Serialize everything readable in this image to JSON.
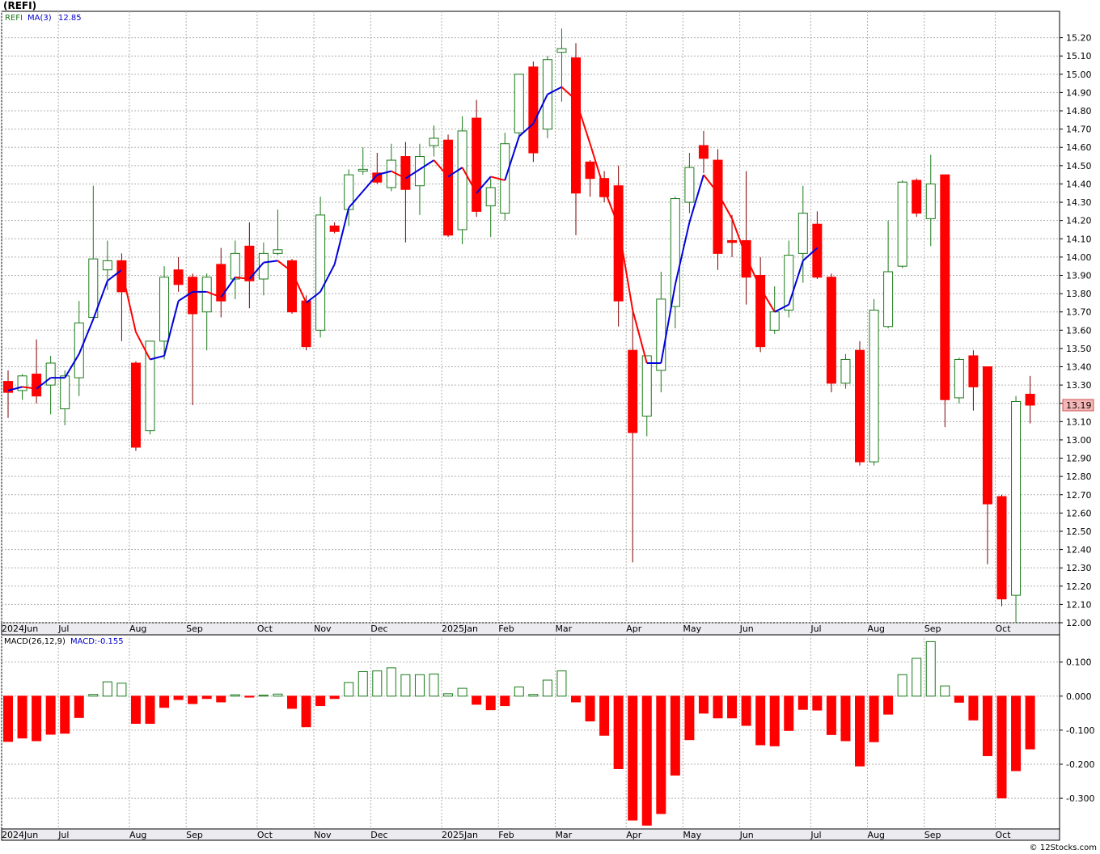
{
  "header": {
    "title": "(REFI)"
  },
  "footer": {
    "credit": "© 12Stocks.com"
  },
  "colors": {
    "up": "#1a7a1a",
    "down": "#ff0000",
    "ma_up": "#0000dd",
    "ma_down": "#ff0000",
    "grid": "#b0b0b0",
    "panel_bg": "#ffffff",
    "axis_bg": "#ececf0"
  },
  "chart_data": [
    {
      "type": "candlestick",
      "legend": {
        "symbol": "REFI",
        "ma_label": "MA(3)",
        "ma_value": "12.85"
      },
      "last_price_label": "13.19",
      "ylim": [
        12.0,
        15.3
      ],
      "y_ticks": [
        "12.00",
        "12.10",
        "12.20",
        "12.30",
        "12.40",
        "12.50",
        "12.60",
        "12.70",
        "12.80",
        "12.90",
        "13.00",
        "13.10",
        "13.20",
        "13.30",
        "13.40",
        "13.50",
        "13.60",
        "13.70",
        "13.80",
        "13.90",
        "14.00",
        "14.10",
        "14.20",
        "14.30",
        "14.40",
        "14.50",
        "14.60",
        "14.70",
        "14.80",
        "14.90",
        "15.00",
        "15.10",
        "15.20"
      ],
      "x_labels": [
        {
          "label": "2024Jun",
          "bar": 0
        },
        {
          "label": "Jul",
          "bar": 4
        },
        {
          "label": "Aug",
          "bar": 9
        },
        {
          "label": "Sep",
          "bar": 13
        },
        {
          "label": "Oct",
          "bar": 18
        },
        {
          "label": "Nov",
          "bar": 22
        },
        {
          "label": "Dec",
          "bar": 26
        },
        {
          "label": "2025Jan",
          "bar": 31
        },
        {
          "label": "Feb",
          "bar": 35
        },
        {
          "label": "Mar",
          "bar": 39
        },
        {
          "label": "Apr",
          "bar": 44
        },
        {
          "label": "May",
          "bar": 48
        },
        {
          "label": "Jun",
          "bar": 52
        },
        {
          "label": "Jul",
          "bar": 57
        },
        {
          "label": "Aug",
          "bar": 61
        },
        {
          "label": "Sep",
          "bar": 65
        },
        {
          "label": "Oct",
          "bar": 70
        }
      ],
      "candles": [
        {
          "o": 13.32,
          "h": 13.38,
          "l": 13.12,
          "c": 13.26
        },
        {
          "o": 13.27,
          "h": 13.36,
          "l": 13.22,
          "c": 13.35
        },
        {
          "o": 13.36,
          "h": 13.55,
          "l": 13.2,
          "c": 13.24
        },
        {
          "o": 13.3,
          "h": 13.46,
          "l": 13.14,
          "c": 13.42
        },
        {
          "o": 13.17,
          "h": 13.38,
          "l": 13.08,
          "c": 13.35
        },
        {
          "o": 13.34,
          "h": 13.76,
          "l": 13.24,
          "c": 13.64
        },
        {
          "o": 13.67,
          "h": 14.39,
          "l": 13.66,
          "c": 13.99
        },
        {
          "o": 13.93,
          "h": 14.09,
          "l": 13.82,
          "c": 13.98
        },
        {
          "o": 13.98,
          "h": 14.02,
          "l": 13.54,
          "c": 13.81
        },
        {
          "o": 13.42,
          "h": 13.43,
          "l": 12.94,
          "c": 12.96
        },
        {
          "o": 13.05,
          "h": 13.54,
          "l": 13.03,
          "c": 13.54
        },
        {
          "o": 13.54,
          "h": 13.95,
          "l": 13.44,
          "c": 13.89
        },
        {
          "o": 13.93,
          "h": 14.0,
          "l": 13.81,
          "c": 13.85
        },
        {
          "o": 13.89,
          "h": 13.91,
          "l": 13.19,
          "c": 13.69
        },
        {
          "o": 13.7,
          "h": 13.91,
          "l": 13.49,
          "c": 13.89
        },
        {
          "o": 13.96,
          "h": 14.05,
          "l": 13.67,
          "c": 13.76
        },
        {
          "o": 13.88,
          "h": 14.09,
          "l": 13.77,
          "c": 14.02
        },
        {
          "o": 14.06,
          "h": 14.19,
          "l": 13.72,
          "c": 13.87
        },
        {
          "o": 13.88,
          "h": 14.08,
          "l": 13.79,
          "c": 14.02
        },
        {
          "o": 14.02,
          "h": 14.26,
          "l": 14.01,
          "c": 14.04
        },
        {
          "o": 13.98,
          "h": 13.99,
          "l": 13.69,
          "c": 13.7
        },
        {
          "o": 13.76,
          "h": 13.79,
          "l": 13.49,
          "c": 13.51
        },
        {
          "o": 13.6,
          "h": 14.33,
          "l": 13.56,
          "c": 14.23
        },
        {
          "o": 14.17,
          "h": 14.19,
          "l": 14.13,
          "c": 14.14
        },
        {
          "o": 14.26,
          "h": 14.48,
          "l": 14.17,
          "c": 14.45
        },
        {
          "o": 14.47,
          "h": 14.6,
          "l": 14.45,
          "c": 14.48
        },
        {
          "o": 14.46,
          "h": 14.57,
          "l": 14.4,
          "c": 14.41
        },
        {
          "o": 14.38,
          "h": 14.62,
          "l": 14.36,
          "c": 14.53
        },
        {
          "o": 14.55,
          "h": 14.63,
          "l": 14.08,
          "c": 14.37
        },
        {
          "o": 14.39,
          "h": 14.62,
          "l": 14.23,
          "c": 14.55
        },
        {
          "o": 14.61,
          "h": 14.72,
          "l": 14.55,
          "c": 14.65
        },
        {
          "o": 14.64,
          "h": 14.67,
          "l": 14.11,
          "c": 14.12
        },
        {
          "o": 14.15,
          "h": 14.77,
          "l": 14.07,
          "c": 14.69
        },
        {
          "o": 14.76,
          "h": 14.86,
          "l": 14.22,
          "c": 14.25
        },
        {
          "o": 14.28,
          "h": 14.43,
          "l": 14.11,
          "c": 14.38
        },
        {
          "o": 14.24,
          "h": 14.68,
          "l": 14.2,
          "c": 14.62
        },
        {
          "o": 14.68,
          "h": 15.0,
          "l": 14.65,
          "c": 15.0
        },
        {
          "o": 15.04,
          "h": 15.07,
          "l": 14.52,
          "c": 14.57
        },
        {
          "o": 14.7,
          "h": 15.1,
          "l": 14.65,
          "c": 15.08
        },
        {
          "o": 15.12,
          "h": 15.25,
          "l": 14.85,
          "c": 15.14
        },
        {
          "o": 15.09,
          "h": 15.17,
          "l": 14.12,
          "c": 14.35
        },
        {
          "o": 14.52,
          "h": 14.53,
          "l": 14.33,
          "c": 14.43
        },
        {
          "o": 14.43,
          "h": 14.47,
          "l": 14.3,
          "c": 14.33
        },
        {
          "o": 14.39,
          "h": 14.5,
          "l": 13.62,
          "c": 13.76
        },
        {
          "o": 13.49,
          "h": 13.71,
          "l": 12.33,
          "c": 13.04
        },
        {
          "o": 13.13,
          "h": 13.46,
          "l": 13.02,
          "c": 13.46
        },
        {
          "o": 13.38,
          "h": 13.92,
          "l": 13.26,
          "c": 13.77
        },
        {
          "o": 13.73,
          "h": 14.33,
          "l": 13.61,
          "c": 14.32
        },
        {
          "o": 14.3,
          "h": 14.57,
          "l": 14.24,
          "c": 14.49
        },
        {
          "o": 14.61,
          "h": 14.69,
          "l": 14.46,
          "c": 14.54
        },
        {
          "o": 14.53,
          "h": 14.59,
          "l": 13.93,
          "c": 14.02
        },
        {
          "o": 14.09,
          "h": 14.23,
          "l": 14.0,
          "c": 14.08
        },
        {
          "o": 14.09,
          "h": 14.47,
          "l": 13.74,
          "c": 13.89
        },
        {
          "o": 13.9,
          "h": 14.0,
          "l": 13.48,
          "c": 13.51
        },
        {
          "o": 13.6,
          "h": 13.84,
          "l": 13.58,
          "c": 13.7
        },
        {
          "o": 13.71,
          "h": 14.09,
          "l": 13.67,
          "c": 14.01
        },
        {
          "o": 14.02,
          "h": 14.39,
          "l": 13.86,
          "c": 14.24
        },
        {
          "o": 14.18,
          "h": 14.25,
          "l": 13.88,
          "c": 13.89
        },
        {
          "o": 13.89,
          "h": 13.91,
          "l": 13.26,
          "c": 13.31
        },
        {
          "o": 13.31,
          "h": 13.47,
          "l": 13.28,
          "c": 13.44
        },
        {
          "o": 13.49,
          "h": 13.54,
          "l": 12.86,
          "c": 12.88
        },
        {
          "o": 12.88,
          "h": 13.77,
          "l": 12.86,
          "c": 13.71
        },
        {
          "o": 13.62,
          "h": 14.2,
          "l": 13.61,
          "c": 13.92
        },
        {
          "o": 13.95,
          "h": 14.42,
          "l": 13.94,
          "c": 14.41
        },
        {
          "o": 14.42,
          "h": 14.43,
          "l": 14.22,
          "c": 14.24
        },
        {
          "o": 14.21,
          "h": 14.56,
          "l": 14.06,
          "c": 14.4
        },
        {
          "o": 14.45,
          "h": 14.45,
          "l": 13.07,
          "c": 13.22
        },
        {
          "o": 13.23,
          "h": 13.45,
          "l": 13.2,
          "c": 13.44
        },
        {
          "o": 13.46,
          "h": 13.49,
          "l": 13.16,
          "c": 13.29
        },
        {
          "o": 13.4,
          "h": 13.4,
          "l": 12.32,
          "c": 12.65
        },
        {
          "o": 12.69,
          "h": 12.7,
          "l": 12.09,
          "c": 12.13
        },
        {
          "o": 12.15,
          "h": 13.24,
          "l": 12.0,
          "c": 13.21
        },
        {
          "o": 13.25,
          "h": 13.35,
          "l": 13.09,
          "c": 13.19
        }
      ],
      "ma3": [
        13.27,
        13.29,
        13.28,
        13.34,
        13.34,
        13.47,
        13.66,
        13.87,
        13.93,
        13.59,
        13.44,
        13.46,
        13.76,
        13.81,
        13.81,
        13.78,
        13.89,
        13.88,
        13.97,
        13.98,
        13.92,
        13.75,
        13.81,
        13.96,
        14.27,
        14.36,
        14.45,
        14.47,
        14.43,
        14.48,
        14.53,
        14.44,
        14.49,
        14.35,
        14.44,
        14.42,
        14.66,
        14.73,
        14.89,
        14.93,
        14.86,
        14.62,
        14.37,
        14.17,
        13.71,
        13.42,
        13.42,
        13.85,
        14.19,
        14.45,
        14.35,
        14.21,
        14.0,
        13.83,
        13.7,
        13.74,
        13.98,
        14.05
      ]
    },
    {
      "type": "bar",
      "legend": {
        "label": "MACD(26,12,9)",
        "value_label": "MACD:-0.155"
      },
      "ylim": [
        -0.39,
        0.18
      ],
      "y_ticks": [
        "0.100",
        "0.000",
        "-0.100",
        "-0.200",
        "-0.300"
      ],
      "y_tick_values": [
        0.1,
        0.0,
        -0.1,
        -0.2,
        -0.3
      ],
      "values": [
        -0.133,
        -0.123,
        -0.131,
        -0.112,
        -0.109,
        -0.063,
        0.005,
        0.042,
        0.038,
        -0.08,
        -0.08,
        -0.033,
        -0.01,
        -0.022,
        -0.007,
        -0.017,
        0.004,
        -0.003,
        0.003,
        0.006,
        -0.036,
        -0.09,
        -0.028,
        -0.007,
        0.04,
        0.072,
        0.074,
        0.083,
        0.063,
        0.063,
        0.065,
        0.007,
        0.023,
        -0.024,
        -0.04,
        -0.028,
        0.027,
        0.005,
        0.047,
        0.074,
        -0.017,
        -0.073,
        -0.115,
        -0.213,
        -0.364,
        -0.379,
        -0.345,
        -0.232,
        -0.128,
        -0.05,
        -0.064,
        -0.064,
        -0.086,
        -0.143,
        -0.146,
        -0.101,
        -0.039,
        -0.041,
        -0.113,
        -0.131,
        -0.205,
        -0.134,
        -0.053,
        0.063,
        0.111,
        0.16,
        0.03,
        -0.018,
        -0.07,
        -0.175,
        -0.299,
        -0.219,
        -0.155
      ]
    }
  ]
}
